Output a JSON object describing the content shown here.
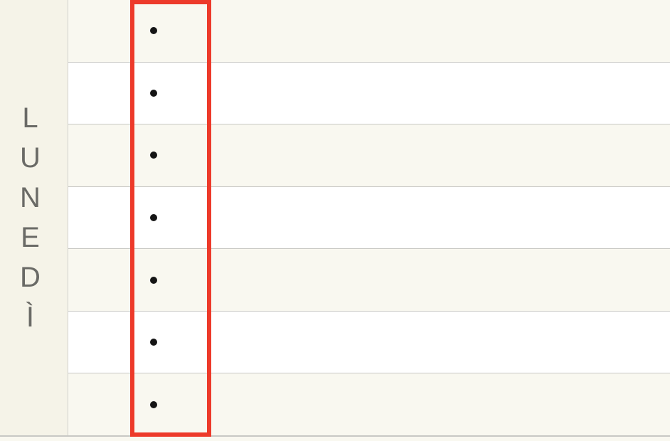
{
  "day_label": "LUNEDÌ",
  "rows": [
    {
      "bullet": "•"
    },
    {
      "bullet": "•"
    },
    {
      "bullet": "•"
    },
    {
      "bullet": "•"
    },
    {
      "bullet": "•"
    },
    {
      "bullet": "•"
    },
    {
      "bullet": "•"
    }
  ],
  "highlight": {
    "color": "#ed3a2a"
  }
}
